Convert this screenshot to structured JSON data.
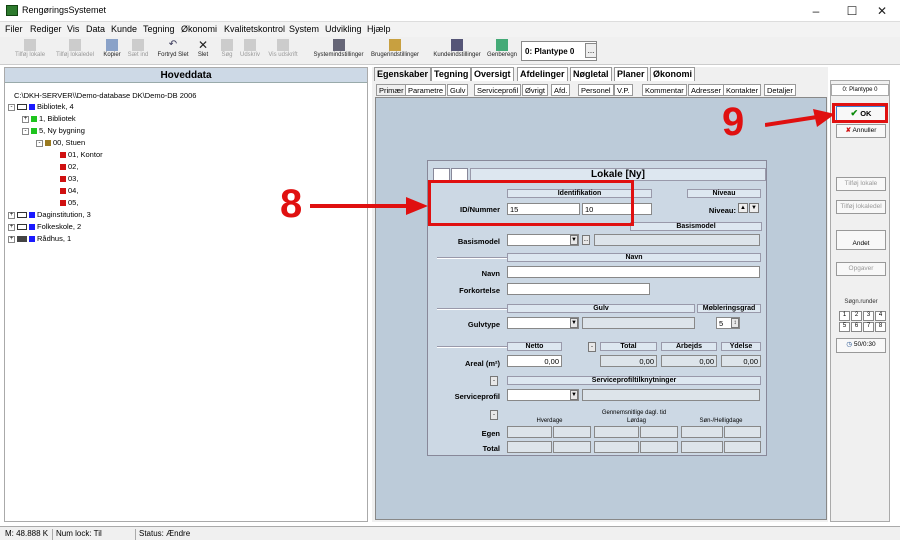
{
  "window": {
    "title": "RengøringsSystemet"
  },
  "menu": [
    "Filer",
    "Rediger",
    "Vis",
    "Data",
    "Kunde",
    "Tegning",
    "Økonomi",
    "Kvalitetskontrol",
    "System",
    "Udvikling",
    "Hjælp"
  ],
  "toolbar": {
    "tilfoej_lokale": "Tilføj lokale",
    "tilfoej_lokaledel": "Tilføj lokaledel",
    "kopier": "Kopier",
    "saet_ind": "Sæt ind",
    "fortryd_slet": "Fortryd Slet",
    "slet": "Slet",
    "soeg": "Søg",
    "udskriv": "Udskriv",
    "vis_udskrift": "Vis udskrift",
    "systemindstillinger": "Systemindstillinger",
    "brugerindstillinger": "Brugerindstillinger",
    "kundeindstillinger": "Kundeindstillinger",
    "genberegn": "Genberegn",
    "plantype": "0: Plantype 0",
    "plantype_more": "..."
  },
  "left_panel": {
    "header": "Hoveddata",
    "tree": [
      {
        "label": "C:\\DKH-SERVER\\\\Demo-database DK\\Demo-DB 2006"
      },
      {
        "label": "Bibliotek, 4"
      },
      {
        "label": "1, Bibliotek"
      },
      {
        "label": "5, Ny bygning"
      },
      {
        "label": "00, Stuen"
      },
      {
        "label": "01, Kontor"
      },
      {
        "label": "02,"
      },
      {
        "label": "03,"
      },
      {
        "label": "04,"
      },
      {
        "label": "05,"
      },
      {
        "label": "Daginstitution, 3"
      },
      {
        "label": "Folkeskole, 2"
      },
      {
        "label": "Rådhus, 1"
      }
    ]
  },
  "main_tabs": [
    "Egenskaber",
    "Tegning",
    "Oversigt",
    "Afdelinger",
    "Nøgletal",
    "Planer",
    "Økonomi"
  ],
  "sub_tabs": [
    "Primær",
    "Parametre",
    "Gulv",
    "Serviceprofil",
    "Øvrigt",
    "Afd.",
    "Personel",
    "V.P.",
    "Kommentar",
    "Adresser",
    "Kontakter",
    "Detaljer"
  ],
  "form": {
    "title": "Lokale [Ny]",
    "identifikation": "Identifikation",
    "niveau_head": "Niveau",
    "id_label": "ID/Nummer",
    "id_value": "15",
    "nummer_value": "10",
    "niveau_label": "Niveau:",
    "basismodel_head": "Basismodel",
    "basismodel_label": "Basismodel",
    "navn_head": "Navn",
    "navn_label": "Navn",
    "forkortelse_label": "Forkortelse",
    "gulv_head": "Gulv",
    "moeblering_head": "Møbleringsgrad",
    "gulvtype_label": "Gulvtype",
    "moeblering_value": "5",
    "netto_head": "Netto",
    "total_head": "Total",
    "arbejds_head": "Arbejds",
    "ydelse_head": "Ydelse",
    "areal_label": "Areal (m²)",
    "netto_value": "0,00",
    "total_value": "0,00",
    "arbejds_value": "0,00",
    "ydelse_value": "0,00",
    "serviceprofil_head": "Serviceprofiltilknytninger",
    "serviceprofil_label": "Serviceprofil",
    "tid_head": "Gennemsnitlige dagl. tid",
    "hverdage": "Hverdage",
    "loerdag": "Lørdag",
    "soen": "Søn-/Helligdage",
    "egen_label": "Egen",
    "total_label": "Total",
    "minus": "-",
    "dots": "..."
  },
  "sidebar": {
    "header": "0: Plantype 0",
    "ok": "OK",
    "annuller": "Annuller",
    "tilfoej_lokale": "Tilføj lokale",
    "tilfoej_lokaledel": "Tilføj lokaledel",
    "andet": "Andet",
    "opgaver": "Opgaver",
    "soegn_head": "Søgn.runder",
    "grid": [
      "1",
      "2",
      "3",
      "4",
      "5",
      "6",
      "7",
      "8"
    ],
    "counter": "50/0:30"
  },
  "annotations": {
    "eight": "8",
    "nine": "9"
  },
  "statusbar": {
    "mem": "M: 48.888 K",
    "numlock": "Num lock: Til",
    "status": "Status: Ændre"
  },
  "colors": {
    "annotation_red": "#e01010",
    "content_bg": "#bccbd9",
    "form_bg": "#ccd8e4"
  }
}
